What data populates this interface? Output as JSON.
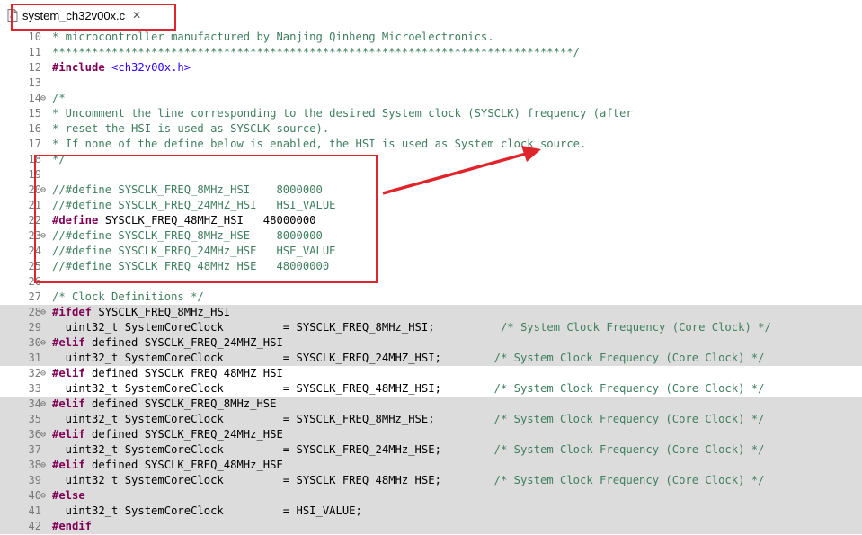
{
  "tab": {
    "filename": "system_ch32v00x.c",
    "close_glyph": "✕",
    "file_icon": "c-file-icon"
  },
  "colors": {
    "highlight": "#e0242c",
    "keyword": "#7f0055",
    "comment": "#3f7f5f",
    "string": "#2a00ff",
    "inactive_bg": "#dcdcdc"
  },
  "lines": [
    {
      "num": "10",
      "fold": "",
      "hl": false,
      "tokens": [
        {
          "t": "* microcontroller manufactured by Nanjing Qinheng Microelectronics.",
          "c": "c"
        }
      ]
    },
    {
      "num": "11",
      "fold": "",
      "hl": false,
      "tokens": [
        {
          "t": "*******************************************************************************/",
          "c": "c"
        }
      ]
    },
    {
      "num": "12",
      "fold": "",
      "hl": false,
      "tokens": [
        {
          "t": "#include",
          "c": "k"
        },
        {
          "t": " "
        },
        {
          "t": "<ch32v00x.h>",
          "c": "s"
        }
      ]
    },
    {
      "num": "13",
      "fold": "",
      "hl": false,
      "tokens": []
    },
    {
      "num": "14",
      "fold": "⊖",
      "hl": false,
      "tokens": [
        {
          "t": "/*",
          "c": "c"
        }
      ]
    },
    {
      "num": "15",
      "fold": "",
      "hl": false,
      "tokens": [
        {
          "t": "* Uncomment the line corresponding to the desired System clock (SYSCLK) frequency (after",
          "c": "c"
        }
      ]
    },
    {
      "num": "16",
      "fold": "",
      "hl": false,
      "tokens": [
        {
          "t": "* reset the HSI is used as SYSCLK source).",
          "c": "c"
        }
      ]
    },
    {
      "num": "17",
      "fold": "",
      "hl": false,
      "tokens": [
        {
          "t": "* If none of the define below is enabled, the HSI is used as System clock source.",
          "c": "c"
        }
      ]
    },
    {
      "num": "18",
      "fold": "",
      "hl": false,
      "tokens": [
        {
          "t": "*/",
          "c": "c"
        }
      ]
    },
    {
      "num": "19",
      "fold": "",
      "hl": false,
      "tokens": []
    },
    {
      "num": "20",
      "fold": "⊖",
      "hl": false,
      "tokens": [
        {
          "t": "//#define SYSCLK_FREQ_8MHz_HSI    8000000",
          "c": "c"
        }
      ]
    },
    {
      "num": "21",
      "fold": "",
      "hl": false,
      "tokens": [
        {
          "t": "//#define SYSCLK_FREQ_24MHZ_HSI   HSI_VALUE",
          "c": "c"
        }
      ]
    },
    {
      "num": "22",
      "fold": "",
      "hl": false,
      "tokens": [
        {
          "t": "#define",
          "c": "k"
        },
        {
          "t": " SYSCLK_FREQ_48MHZ_HSI   48000000"
        }
      ]
    },
    {
      "num": "23",
      "fold": "⊖",
      "hl": false,
      "tokens": [
        {
          "t": "//#define SYSCLK_FREQ_8MHz_HSE    8000000",
          "c": "c"
        }
      ]
    },
    {
      "num": "24",
      "fold": "",
      "hl": false,
      "tokens": [
        {
          "t": "//#define SYSCLK_FREQ_24MHz_HSE   HSE_VALUE",
          "c": "c"
        }
      ]
    },
    {
      "num": "25",
      "fold": "",
      "hl": false,
      "tokens": [
        {
          "t": "//#define SYSCLK_FREQ_48MHz_HSE   48000000",
          "c": "c"
        }
      ]
    },
    {
      "num": "26",
      "fold": "",
      "hl": false,
      "tokens": []
    },
    {
      "num": "27",
      "fold": "",
      "hl": false,
      "tokens": [
        {
          "t": "/* Clock Definitions */",
          "c": "c"
        }
      ]
    },
    {
      "num": "28",
      "fold": "⊖",
      "hl": true,
      "tokens": [
        {
          "t": "#ifdef",
          "c": "k"
        },
        {
          "t": " SYSCLK_FREQ_8MHz_HSI"
        }
      ]
    },
    {
      "num": "29",
      "fold": "",
      "hl": true,
      "tokens": [
        {
          "t": "  uint32_t SystemCoreClock         = SYSCLK_FREQ_8MHz_HSI;          "
        },
        {
          "t": "/* System Clock Frequency (Core Clock) */",
          "c": "c"
        }
      ]
    },
    {
      "num": "30",
      "fold": "⊖",
      "hl": true,
      "tokens": [
        {
          "t": "#elif",
          "c": "k"
        },
        {
          "t": " defined SYSCLK_FREQ_24MHZ_HSI"
        }
      ]
    },
    {
      "num": "31",
      "fold": "",
      "hl": true,
      "tokens": [
        {
          "t": "  uint32_t SystemCoreClock         = SYSCLK_FREQ_24MHZ_HSI;        "
        },
        {
          "t": "/* System Clock Frequency (Core Clock) */",
          "c": "c"
        }
      ]
    },
    {
      "num": "32",
      "fold": "⊖",
      "hl": false,
      "tokens": [
        {
          "t": "#elif",
          "c": "k"
        },
        {
          "t": " defined SYSCLK_FREQ_48MHZ_HSI"
        }
      ]
    },
    {
      "num": "33",
      "fold": "",
      "hl": false,
      "tokens": [
        {
          "t": "  uint32_t SystemCoreClock         = SYSCLK_FREQ_48MHZ_HSI;        "
        },
        {
          "t": "/* System Clock Frequency (Core Clock) */",
          "c": "c"
        }
      ]
    },
    {
      "num": "34",
      "fold": "⊖",
      "hl": true,
      "tokens": [
        {
          "t": "#elif",
          "c": "k"
        },
        {
          "t": " defined SYSCLK_FREQ_8MHz_HSE"
        }
      ]
    },
    {
      "num": "35",
      "fold": "",
      "hl": true,
      "tokens": [
        {
          "t": "  uint32_t SystemCoreClock         = SYSCLK_FREQ_8MHz_HSE;         "
        },
        {
          "t": "/* System Clock Frequency (Core Clock) */",
          "c": "c"
        }
      ]
    },
    {
      "num": "36",
      "fold": "⊖",
      "hl": true,
      "tokens": [
        {
          "t": "#elif",
          "c": "k"
        },
        {
          "t": " defined SYSCLK_FREQ_24MHz_HSE"
        }
      ]
    },
    {
      "num": "37",
      "fold": "",
      "hl": true,
      "tokens": [
        {
          "t": "  uint32_t SystemCoreClock         = SYSCLK_FREQ_24MHz_HSE;        "
        },
        {
          "t": "/* System Clock Frequency (Core Clock) */",
          "c": "c"
        }
      ]
    },
    {
      "num": "38",
      "fold": "⊖",
      "hl": true,
      "tokens": [
        {
          "t": "#elif",
          "c": "k"
        },
        {
          "t": " defined SYSCLK_FREQ_48MHz_HSE"
        }
      ]
    },
    {
      "num": "39",
      "fold": "",
      "hl": true,
      "tokens": [
        {
          "t": "  uint32_t SystemCoreClock         = SYSCLK_FREQ_48MHz_HSE;        "
        },
        {
          "t": "/* System Clock Frequency (Core Clock) */",
          "c": "c"
        }
      ]
    },
    {
      "num": "40",
      "fold": "⊖",
      "hl": true,
      "tokens": [
        {
          "t": "#else",
          "c": "k"
        }
      ]
    },
    {
      "num": "41",
      "fold": "",
      "hl": true,
      "tokens": [
        {
          "t": "  uint32_t SystemCoreClock         = HSI_VALUE;"
        }
      ]
    },
    {
      "num": "42",
      "fold": "",
      "hl": true,
      "tokens": [
        {
          "t": "#endif",
          "c": "k"
        }
      ]
    }
  ]
}
